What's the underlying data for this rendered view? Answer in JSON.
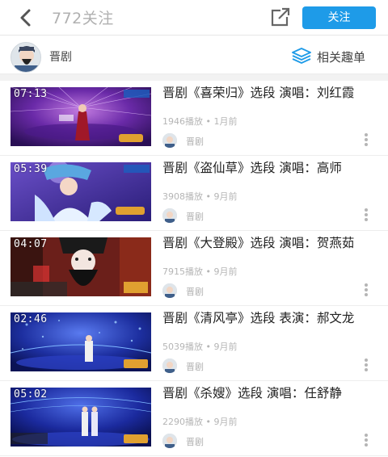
{
  "header": {
    "title": "772关注",
    "follow_label": "关注",
    "back_icon": "chevron-left-icon",
    "share_icon": "share-icon"
  },
  "channel": {
    "name": "晋剧",
    "related_label": "相关趣单",
    "related_icon": "layers-icon"
  },
  "colors": {
    "accent": "#1e9be8"
  },
  "videos": [
    {
      "duration": "07:13",
      "title": "晋剧《喜荣归》选段 演唱：刘红霞",
      "plays": "1946播放",
      "age": "1月前",
      "uploader": "晋剧"
    },
    {
      "duration": "05:39",
      "title": "晋剧《盗仙草》选段 演唱：高师",
      "plays": "3908播放",
      "age": "9月前",
      "uploader": "晋剧"
    },
    {
      "duration": "04:07",
      "title": "晋剧《大登殿》选段 演唱：贺燕茹",
      "plays": "7915播放",
      "age": "9月前",
      "uploader": "晋剧"
    },
    {
      "duration": "02:46",
      "title": "晋剧《清风亭》选段 表演：郝文龙",
      "plays": "5039播放",
      "age": "9月前",
      "uploader": "晋剧"
    },
    {
      "duration": "05:02",
      "title": "晋剧《杀嫂》选段 演唱：任舒静",
      "plays": "2290播放",
      "age": "9月前",
      "uploader": "晋剧"
    }
  ]
}
